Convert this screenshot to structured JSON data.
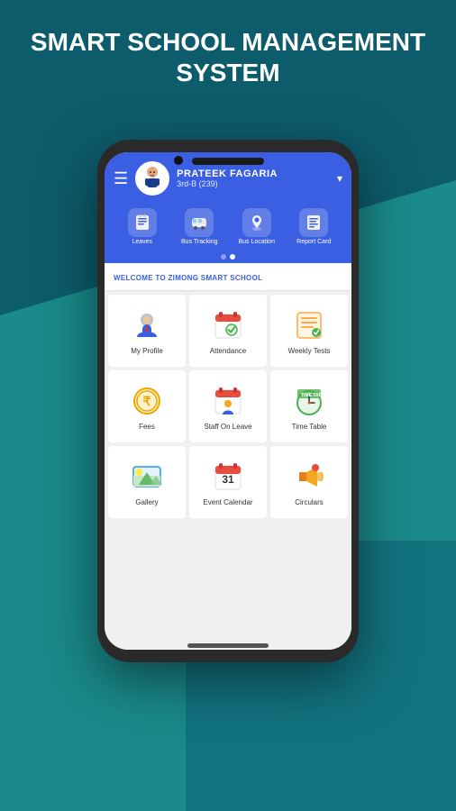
{
  "background": {
    "color_primary": "#1a8a8a",
    "color_secondary": "#0d5c6b"
  },
  "app_title": {
    "line1": "SMART SCHOOL MANAGEMENT",
    "line2": "SYSTEM"
  },
  "header": {
    "user_name": "PRATEEK FAGARIA",
    "user_class": "3rd-B (239)",
    "hamburger_label": "☰"
  },
  "nav_items": [
    {
      "label": "Leaves",
      "icon": "📋"
    },
    {
      "label": "Bus Tracking",
      "icon": "🚌"
    },
    {
      "label": "Bus Location",
      "icon": "📍"
    },
    {
      "label": "Report Card",
      "icon": "📄"
    }
  ],
  "dots": [
    {
      "active": false
    },
    {
      "active": true
    }
  ],
  "welcome_text": "WELCOME TO ZIMONG SMART SCHOOL",
  "grid_items": [
    {
      "label": "My Profile",
      "icon_type": "profile"
    },
    {
      "label": "Attendance",
      "icon_type": "attendance"
    },
    {
      "label": "Weekly Tests",
      "icon_type": "weekly_tests"
    },
    {
      "label": "Fees",
      "icon_type": "fees"
    },
    {
      "label": "Staff On Leave",
      "icon_type": "staff_leave"
    },
    {
      "label": "Time Table",
      "icon_type": "timetable"
    },
    {
      "label": "Gallery",
      "icon_type": "gallery"
    },
    {
      "label": "Event Calendar",
      "icon_type": "event_calendar"
    },
    {
      "label": "Circulars",
      "icon_type": "circulars"
    }
  ]
}
